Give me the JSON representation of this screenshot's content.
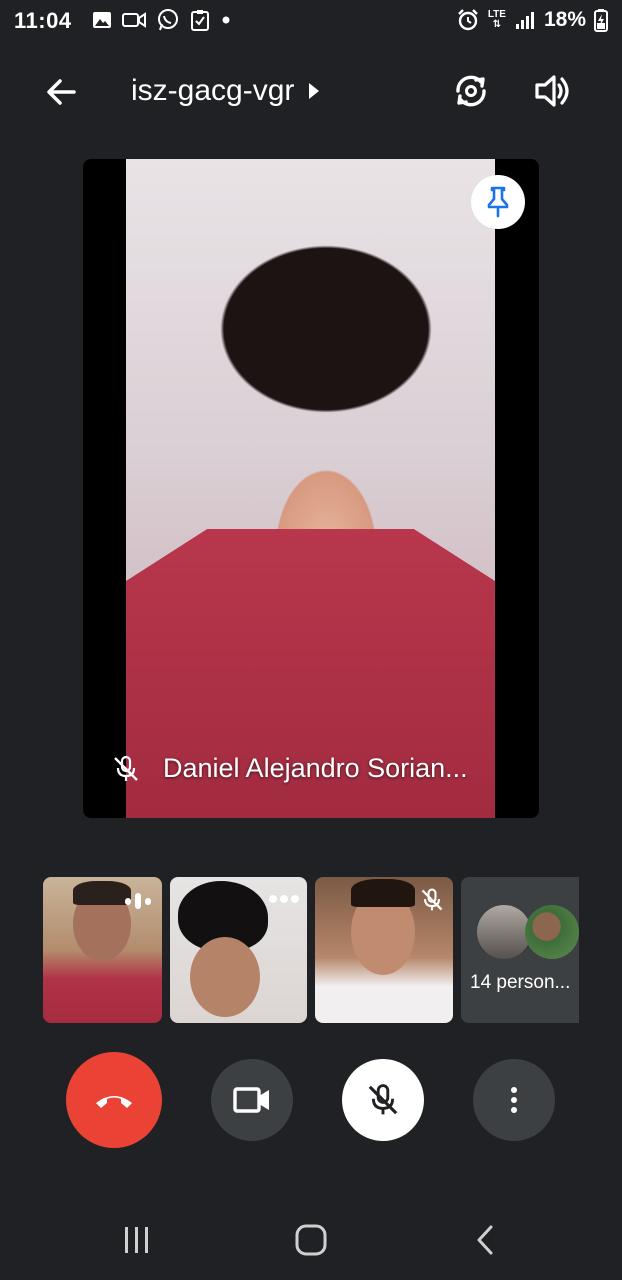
{
  "status_bar": {
    "time": "11:04",
    "network": "LTE",
    "battery": "18%",
    "icons_left": [
      "gallery-icon",
      "video-icon",
      "whatsapp-icon",
      "task-check-icon",
      "dot-icon"
    ],
    "icons_right": [
      "alarm-icon",
      "lte-icon",
      "signal-icon",
      "battery-charging-icon"
    ]
  },
  "app_bar": {
    "meeting_code": "isz-gacg-vgr"
  },
  "main_tile": {
    "participant_name": "Daniel Alejandro Sorian...",
    "muted": true,
    "pinned": true
  },
  "thumbnails": [
    {
      "id": 1,
      "indicator": "speaking"
    },
    {
      "id": 2,
      "indicator": "more"
    },
    {
      "id": 3,
      "indicator": "muted"
    }
  ],
  "more_people": {
    "label": "14 person..."
  },
  "colors": {
    "background": "#202124",
    "end_call": "#ea4335",
    "control_dark": "#3c4043",
    "pin_blue": "#1a73e8"
  }
}
